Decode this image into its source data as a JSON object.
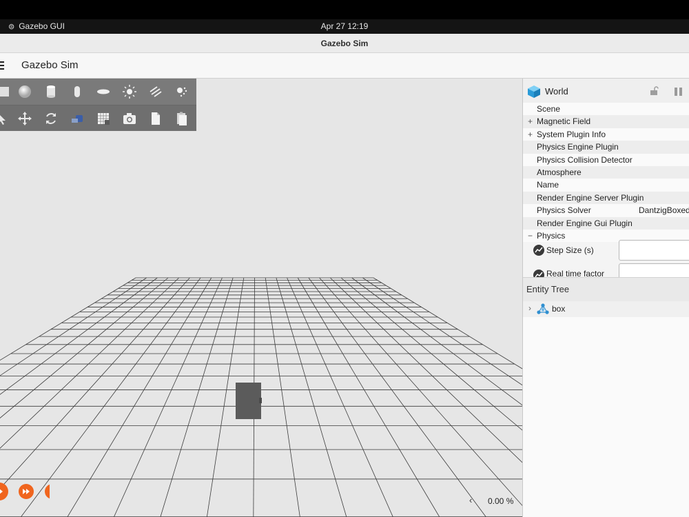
{
  "os": {
    "app_name": "Gazebo GUI",
    "clock": "Apr 27  12:19"
  },
  "window": {
    "title": "Gazebo Sim"
  },
  "header": {
    "title": "Gazebo Sim"
  },
  "toolbar": {
    "row1": [
      "box-shape-icon",
      "sphere-shape-icon",
      "cylinder-shape-icon",
      "capsule-shape-icon",
      "ellipsoid-shape-icon",
      "point-light-icon",
      "directional-light-icon",
      "spot-light-icon"
    ],
    "row2": [
      "select-icon",
      "translate-icon",
      "rotate-icon",
      "transform-control-icon",
      "grid-config-icon",
      "screenshot-icon",
      "copy-icon",
      "paste-icon"
    ]
  },
  "scene": {
    "background": "#e6e6e6",
    "object": "box",
    "real_time_factor": "0.00 %",
    "accent": "#f0651e"
  },
  "world": {
    "title": "World",
    "properties": [
      {
        "prefix": "",
        "label": "Scene",
        "value": ""
      },
      {
        "prefix": "+",
        "label": "Magnetic Field",
        "value": ""
      },
      {
        "prefix": "+",
        "label": "System Plugin Info",
        "value": ""
      },
      {
        "prefix": "",
        "label": "Physics Engine Plugin",
        "value": ""
      },
      {
        "prefix": "",
        "label": "Physics Collision Detector",
        "value": ""
      },
      {
        "prefix": "",
        "label": "Atmosphere",
        "value": ""
      },
      {
        "prefix": "",
        "label": "Name",
        "value": ""
      },
      {
        "prefix": "",
        "label": "Render Engine Server Plugin",
        "value": ""
      },
      {
        "prefix": "",
        "label": "Physics Solver",
        "value": "DantzigBoxed"
      },
      {
        "prefix": "",
        "label": "Render Engine Gui Plugin",
        "value": ""
      },
      {
        "prefix": "−",
        "label": "Physics",
        "value": ""
      }
    ],
    "physics_fields": {
      "step_size_label": "Step Size (s)",
      "rtf_label": "Real time factor"
    }
  },
  "entity_tree": {
    "title": "Entity Tree",
    "items": [
      {
        "label": "box"
      }
    ]
  }
}
